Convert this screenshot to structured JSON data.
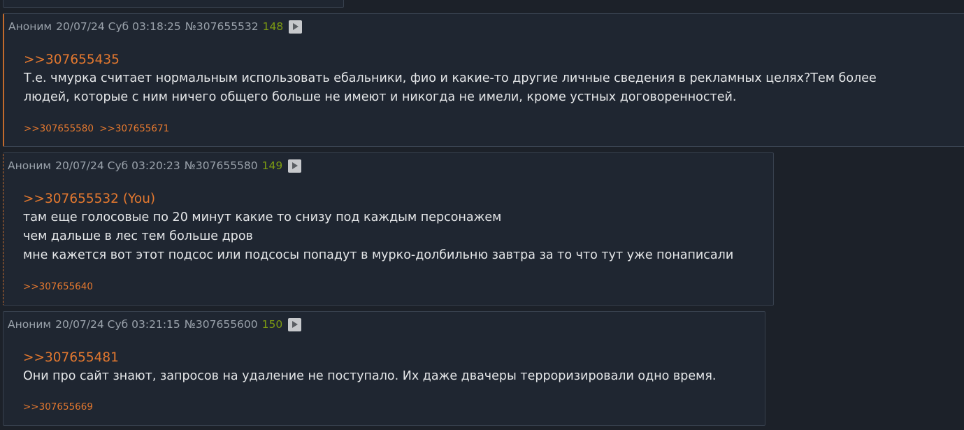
{
  "posts": [
    {
      "author": "Аноним",
      "date": "20/07/24 Суб 03:18:25",
      "id": "№307655532",
      "number": "148",
      "reply_to": ">>307655435",
      "lines": [
        "Т.е. чмурка считает нормальным использовать ебальники, фио и какие-то другие личные сведения в рекламных целях?Тем более",
        "людей, которые с ним ничего общего больше не имеют и никогда не имели, кроме устных договоренностей."
      ],
      "backrefs": [
        ">>307655580",
        ">>307655671"
      ]
    },
    {
      "author": "Аноним",
      "date": "20/07/24 Суб 03:20:23",
      "id": "№307655580",
      "number": "149",
      "reply_to": ">>307655532 (You)",
      "lines": [
        "там еще голосовые по 20 минут какие то снизу под каждым персонажем",
        "чем дальше в лес тем больше дров",
        "мне кажется вот этот подсос или подсосы попадут в мурко-долбильню завтра за то что тут уже понаписали"
      ],
      "backrefs": [
        ">>307655640"
      ]
    },
    {
      "author": "Аноним",
      "date": "20/07/24 Суб 03:21:15",
      "id": "№307655600",
      "number": "150",
      "reply_to": ">>307655481",
      "lines": [
        "Они про сайт знают, запросов на удаление не поступало. Их даже двачеры терроризировали одно время."
      ],
      "backrefs": [
        ">>307655669"
      ]
    }
  ],
  "colors": {
    "background": "#1c2129",
    "post_background": "#1f2631",
    "post_border": "#37404d",
    "link": "#e3782f",
    "post_number": "#7c9a12",
    "meta_text": "#9aa2ab",
    "body_text": "#e4e6e8"
  },
  "icons": {
    "play": "play-icon"
  }
}
